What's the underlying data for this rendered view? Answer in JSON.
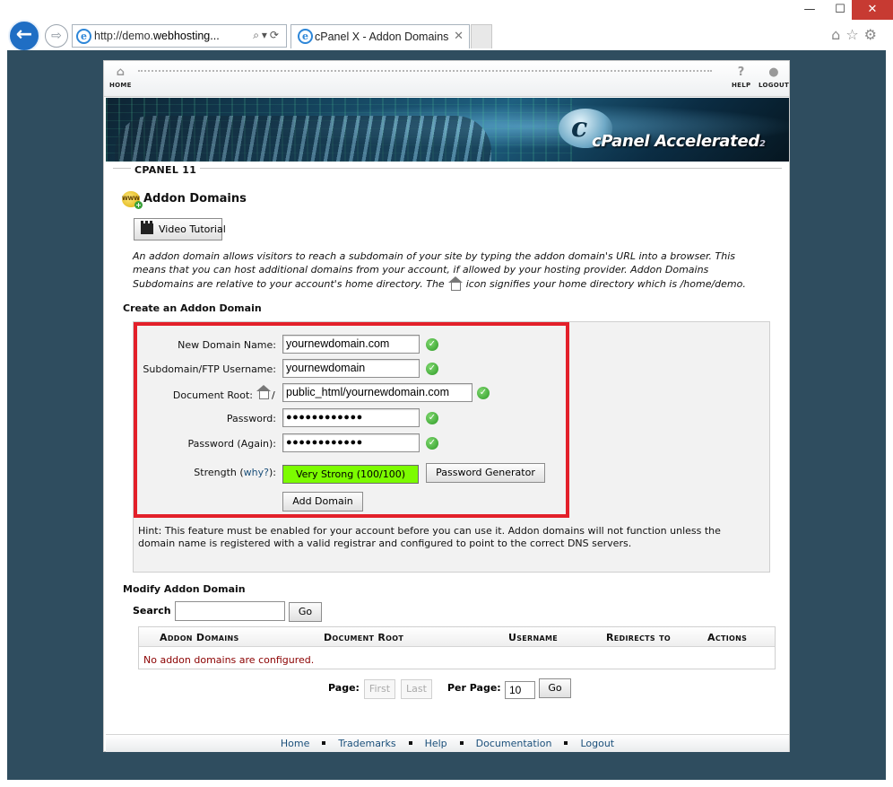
{
  "browser": {
    "address_prefix": "http://demo.",
    "address_domain": "webhosting...",
    "address_tools": "⌕▾⟳",
    "tab_title": "cPanel X - Addon Domains",
    "tab_close": "✕",
    "window_controls": {
      "minimize": "—",
      "maximize": "☐",
      "close": "✕"
    },
    "right_icons": "⌂☆⚙"
  },
  "topbar": {
    "home_label": "HOME",
    "help_label": "HELP",
    "logout_label": "LOGOUT"
  },
  "banner": {
    "logo_letter": "c",
    "logo_brand": "cPanel",
    "logo_tagline": "Accelerated",
    "logo_sub": "2"
  },
  "strip_label": "CPANEL 11",
  "page": {
    "title": "Addon Domains",
    "video_button": "Video Tutorial",
    "desc_part1": "An addon domain allows visitors to reach a subdomain of your site by typing the addon domain's URL into a browser. This means that you can host additional domains from your account, if allowed by your hosting provider. Addon Domains Subdomains are relative to your account's home directory. The",
    "desc_part2": "icon signifies your home directory which is /home/demo."
  },
  "create": {
    "heading": "Create an Addon Domain",
    "new_domain_label": "New Domain Name:",
    "new_domain_value": "yournewdomain.com",
    "username_label": "Subdomain/FTP Username:",
    "username_value": "yournewdomain",
    "docroot_label": "Document Root:",
    "docroot_slash": "/",
    "docroot_value": "public_html/yournewdomain.com",
    "password_label": "Password:",
    "password_value": "●●●●●●●●●●●●",
    "password_again_label": "Password (Again):",
    "password_again_value": "●●●●●●●●●●●●",
    "strength_label": "Strength",
    "why_link": "why?",
    "strength_value": "Very Strong (100/100)",
    "password_generator_button": "Password Generator",
    "add_domain_button": "Add Domain",
    "hint": "Hint: This feature must be enabled for your account before you can use it. Addon domains will not function unless the domain name is registered with a valid registrar and configured to point to the correct DNS servers."
  },
  "modify": {
    "heading": "Modify Addon Domain",
    "search_label": "Search",
    "search_value": "",
    "go_button": "Go",
    "columns": [
      "Addon Domains",
      "Document Root",
      "Username",
      "Redirects to",
      "Actions"
    ],
    "empty_message": "No addon domains are configured.",
    "page_label": "Page:",
    "first_button": "First",
    "last_button": "Last",
    "per_page_label": "Per Page:",
    "per_page_value": "10",
    "per_page_go": "Go"
  },
  "footer": {
    "links": [
      "Home",
      "Trademarks",
      "Help",
      "Documentation",
      "Logout"
    ]
  },
  "colors": {
    "viewport_bg": "#2f4d5f",
    "highlight_border": "#e3202a",
    "strength_bg": "#7cfc00",
    "link": "#1a4f7a",
    "error_text": "#8b0000"
  }
}
